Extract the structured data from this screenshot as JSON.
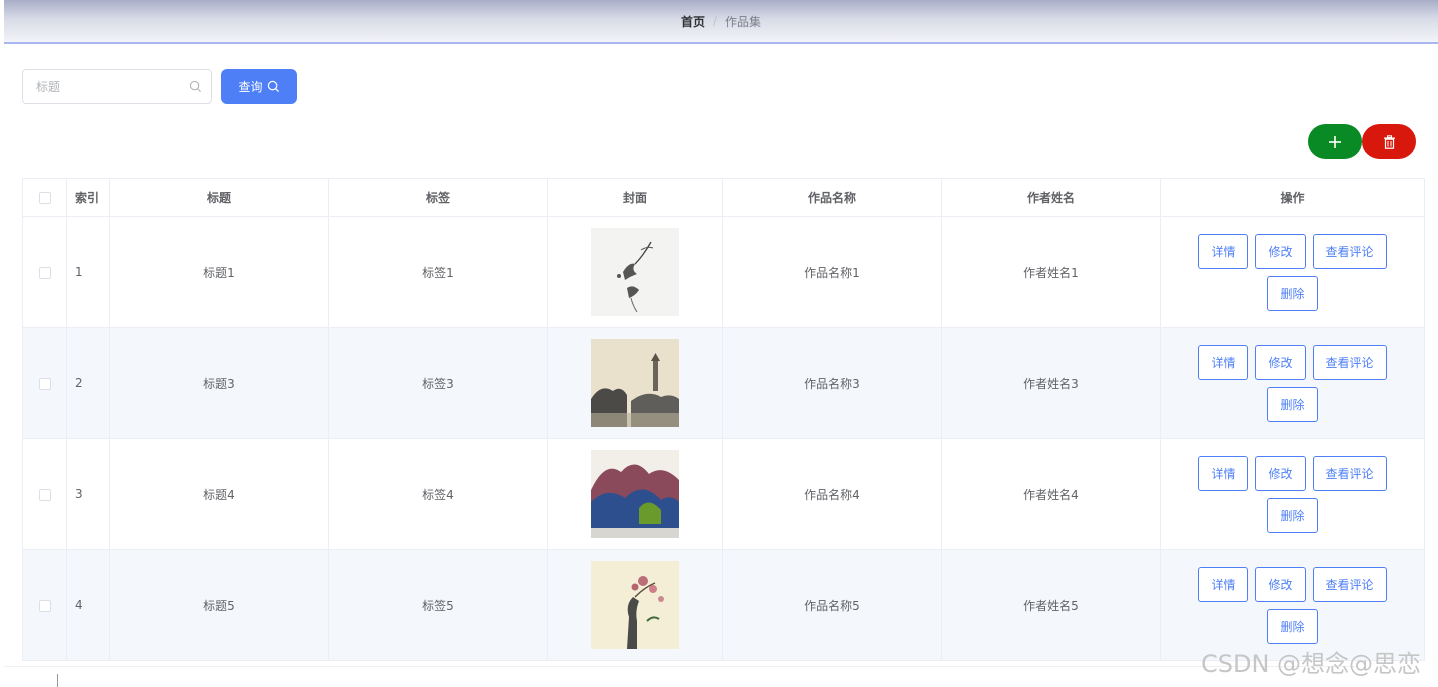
{
  "breadcrumb": {
    "home": "首页",
    "separator": "/",
    "current": "作品集"
  },
  "search": {
    "placeholder": "标题",
    "value": "",
    "button_label": "查询"
  },
  "colors": {
    "primary": "#4e7ff6",
    "add": "#0a8a24",
    "delete": "#d8180c",
    "stripe": "#f4f8fc"
  },
  "table": {
    "headers": [
      "",
      "索引",
      "标题",
      "标签",
      "封面",
      "作品名称",
      "作者姓名",
      "操作"
    ],
    "rows": [
      {
        "index": "1",
        "title": "标题1",
        "tag": "标签1",
        "work_name": "作品名称1",
        "author": "作者姓名1",
        "cover": "ink-bird-painting"
      },
      {
        "index": "2",
        "title": "标题3",
        "tag": "标签3",
        "work_name": "作品名称3",
        "author": "作者姓名3",
        "cover": "ink-pagoda-landscape"
      },
      {
        "index": "3",
        "title": "标题4",
        "tag": "标签4",
        "work_name": "作品名称4",
        "author": "作者姓名4",
        "cover": "blue-mountain-landscape"
      },
      {
        "index": "4",
        "title": "标题5",
        "tag": "标签5",
        "work_name": "作品名称5",
        "author": "作者姓名5",
        "cover": "plum-blossom-rock"
      }
    ],
    "actions": {
      "detail": "详情",
      "edit": "修改",
      "comments": "查看评论",
      "delete": "删除"
    }
  },
  "watermark": "CSDN @想念@思恋"
}
